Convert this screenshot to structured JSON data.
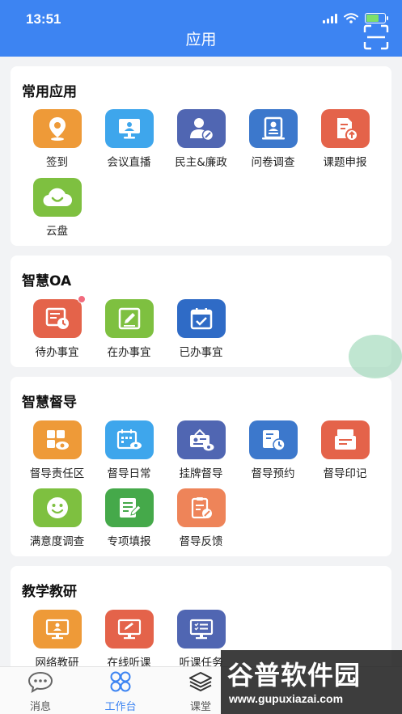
{
  "status_bar": {
    "time": "13:51"
  },
  "header": {
    "title": "应用"
  },
  "sections": [
    {
      "title": "常用应用",
      "apps": [
        {
          "label": "签到",
          "icon": "location-pin-icon",
          "color": "#ee9a38"
        },
        {
          "label": "会议直播",
          "icon": "monitor-icon",
          "color": "#3ea6ec"
        },
        {
          "label": "民主&廉政",
          "icon": "user-edit-icon",
          "color": "#5066b2"
        },
        {
          "label": "问卷调查",
          "icon": "id-card-icon",
          "color": "#3c78cc"
        },
        {
          "label": "课题申报",
          "icon": "document-upload-icon",
          "color": "#e4634a"
        },
        {
          "label": "云盘",
          "icon": "cloud-icon",
          "color": "#7ec040"
        }
      ]
    },
    {
      "title": "智慧OA",
      "apps": [
        {
          "label": "待办事宜",
          "icon": "clock-board-icon",
          "color": "#e4634a",
          "badge": true
        },
        {
          "label": "在办事宜",
          "icon": "edit-board-icon",
          "color": "#7ec040"
        },
        {
          "label": "已办事宜",
          "icon": "calendar-check-icon",
          "color": "#2f6bc6"
        }
      ]
    },
    {
      "title": "智慧督导",
      "apps": [
        {
          "label": "督导责任区",
          "icon": "grid-eye-icon",
          "color": "#ee9a38"
        },
        {
          "label": "督导日常",
          "icon": "calendar-eye-icon",
          "color": "#3ea6ec"
        },
        {
          "label": "挂牌督导",
          "icon": "badge-eye-icon",
          "color": "#5066b2"
        },
        {
          "label": "督导预约",
          "icon": "schedule-clock-icon",
          "color": "#3c78cc"
        },
        {
          "label": "督导印记",
          "icon": "stamp-eye-icon",
          "color": "#e4634a"
        },
        {
          "label": "满意度调查",
          "icon": "smile-icon",
          "color": "#7ec040"
        },
        {
          "label": "专项填报",
          "icon": "form-pen-icon",
          "color": "#45a94a"
        },
        {
          "label": "督导反馈",
          "icon": "clipboard-edit-icon",
          "color": "#ee8459"
        }
      ]
    },
    {
      "title": "教学教研",
      "apps": [
        {
          "label": "网络教研",
          "icon": "presentation-icon",
          "color": "#ee9a38"
        },
        {
          "label": "在线听课",
          "icon": "screen-pen-icon",
          "color": "#e4634a"
        },
        {
          "label": "听课任务",
          "icon": "screen-list-icon",
          "color": "#5066b2"
        }
      ]
    }
  ],
  "tabbar": [
    {
      "label": "消息",
      "icon": "chat-icon"
    },
    {
      "label": "工作台",
      "icon": "workbench-icon",
      "active": true
    },
    {
      "label": "课堂",
      "icon": "layers-icon"
    }
  ],
  "watermark": {
    "text": "谷普软件园",
    "url": "www.gupuxiazai.com"
  }
}
